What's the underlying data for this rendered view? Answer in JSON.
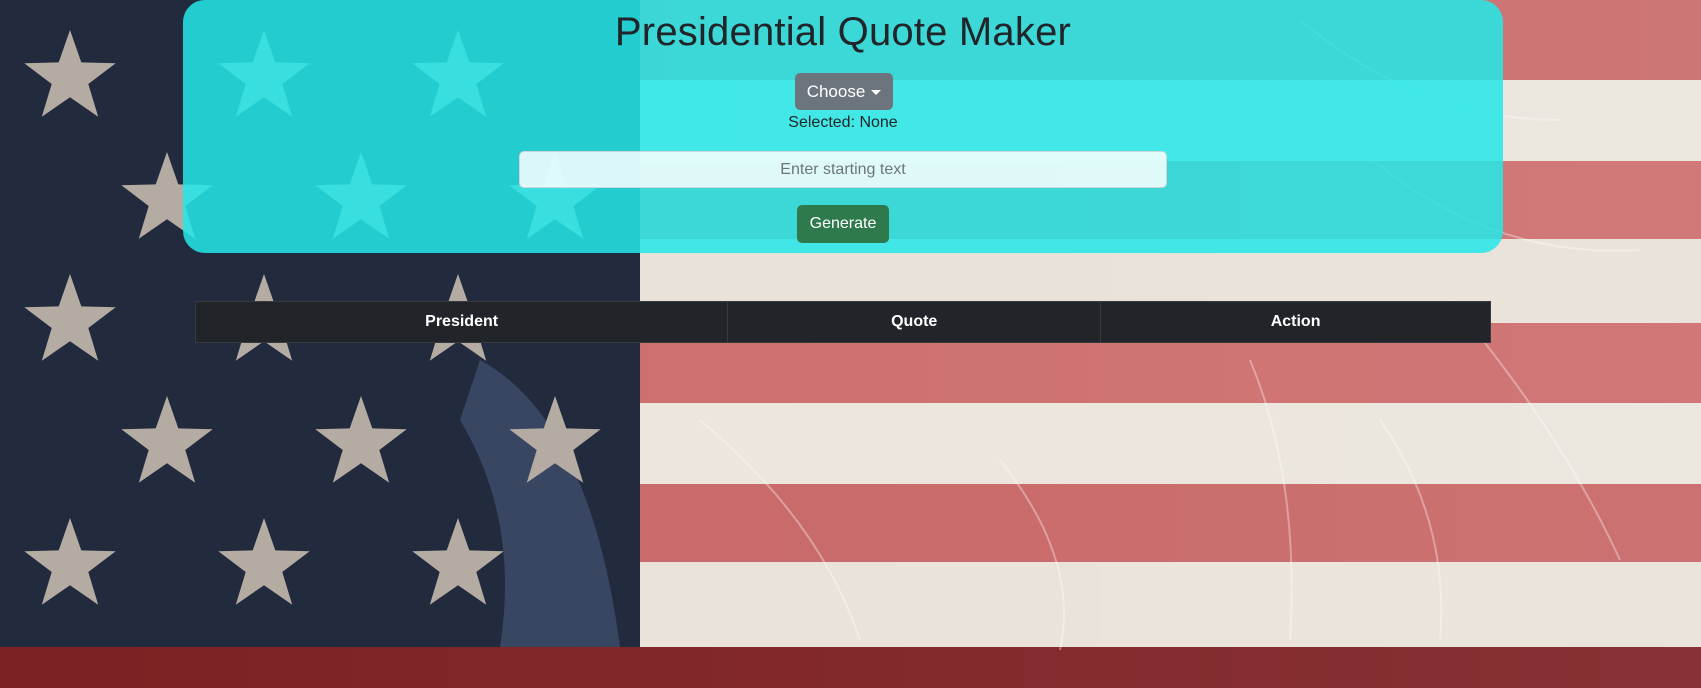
{
  "app": {
    "title": "Presidential Quote Maker"
  },
  "controls": {
    "choose_label": "Choose",
    "selected_text": "Selected: None",
    "start_input": {
      "value": "",
      "placeholder": "Enter starting text"
    },
    "generate_label": "Generate"
  },
  "table": {
    "columns": [
      "President",
      "Quote",
      "Action"
    ],
    "rows": []
  },
  "colors": {
    "panel": "#24e8e8",
    "choose_button": "#6c757d",
    "generate_button": "#2f7a4d",
    "table_header": "#212529"
  }
}
